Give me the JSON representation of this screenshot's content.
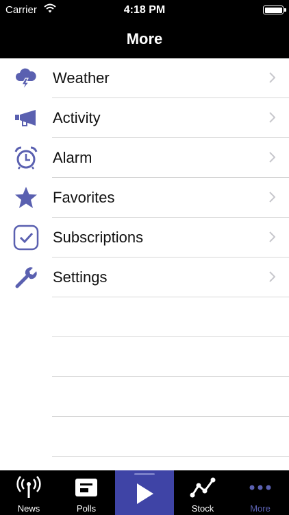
{
  "status_bar": {
    "carrier": "Carrier",
    "time": "4:18 PM"
  },
  "nav": {
    "title": "More"
  },
  "menu_items": [
    {
      "label": "Weather",
      "icon": "weather-icon"
    },
    {
      "label": "Activity",
      "icon": "megaphone-icon"
    },
    {
      "label": "Alarm",
      "icon": "alarm-clock-icon"
    },
    {
      "label": "Favorites",
      "icon": "star-icon"
    },
    {
      "label": "Subscriptions",
      "icon": "checkbox-icon"
    },
    {
      "label": "Settings",
      "icon": "wrench-icon"
    }
  ],
  "tab_bar": {
    "tabs": [
      {
        "label": "News",
        "icon": "antenna-icon"
      },
      {
        "label": "Polls",
        "icon": "ballot-box-icon"
      },
      {
        "label": "",
        "icon": "play-icon"
      },
      {
        "label": "Stock",
        "icon": "stock-chart-icon"
      },
      {
        "label": "More",
        "icon": "more-dots-icon",
        "selected": true
      }
    ]
  },
  "colors": {
    "accent": "#5a60b0",
    "play_bg": "#3f44a6",
    "bar_bg": "#000000"
  }
}
